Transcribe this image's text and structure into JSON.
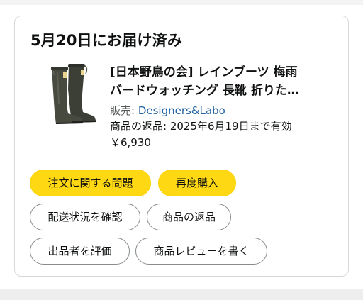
{
  "delivery": {
    "status": "5月20日にお届け済み"
  },
  "product": {
    "image_icon": "rain-boots-image",
    "title_line1": "[日本野鳥の会] レインブーツ 梅雨",
    "title_line2": "バードウォッチング 長靴 折りた…",
    "seller_prefix": "販売: ",
    "seller_name": "Designers&Labo",
    "return_info": "商品の返品: 2025年6月19日まで有効",
    "price": "￥6,930"
  },
  "actions": {
    "problem": "注文に関する問題",
    "buy_again": "再度購入",
    "track": "配送状況を確認",
    "return": "商品の返品",
    "rate_seller": "出品者を評価",
    "write_review": "商品レビューを書く"
  },
  "colors": {
    "accent_yellow": "#ffd814",
    "link_blue": "#2162a1",
    "border_gray": "#888c8c"
  }
}
